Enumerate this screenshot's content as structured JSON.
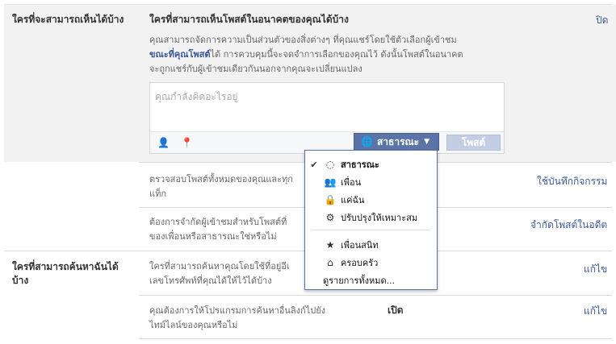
{
  "section1": {
    "title": "ใครที่จะสามารถเห็นได้บ้าง",
    "future_posts": {
      "heading": "ใครที่สามารถเห็นโพสต์ในอนาคตของคุณได้บ้าง",
      "close_link": "ปิด",
      "desc_line1": "คุณสามารถจัดการความเป็นส่วนตัวของสิ่งต่างๆ ที่คุณแชร์โดยใช้ตัวเลือกผู้เข้าชม",
      "desc_inline_link": "ขณะที่คุณโพสต์",
      "desc_line2_rest": "ได้ การควบคุมนี้จะจดจำการเลือกของคุณไว้ ดังนั้นโพสต์ในอนาคต",
      "desc_line3": "จะถูกแชร์กับผู้เข้าชมเดียวกันนอกจากคุณจะเปลี่ยนแปลง",
      "composer_placeholder": "คุณกำลังคิดอะไรอยู่",
      "audience_button": "สาธารณะ",
      "post_button": "โพสต์"
    },
    "row2": {
      "line1": "ตรวจสอบโพสต์ทั้งหมดของคุณและทุก",
      "line2": "แท็ก",
      "link": "ใช้บันทึกกิจกรรม"
    },
    "row3": {
      "line1": "ต้องการจำกัดผู้เข้าชมสำหรับโพสต์ที่",
      "line2": "ของเพื่อนหรือสาธารณะใช่หรือไม่",
      "link": "จำกัดโพสต์ในอดีต"
    }
  },
  "section2": {
    "title_line1": "ใครที่สามารถค้นหาฉันได้",
    "title_line2": "บ้าง",
    "row1": {
      "line1": "ใครที่สามารถค้นหาคุณโดยใช้ที่อยู่อีเ",
      "line2": "เลขโทรศัพท์ที่คุณได้ให้ไว้ได้บ้าง",
      "link": "แก้ไข"
    },
    "row2": {
      "line1": "คุณต้องการให้โปรแกรมการค้นหาอื่นลิงก์ไปยัง",
      "line2": "ไทม์ไลน์ของคุณหรือไม่",
      "value": "เปิด",
      "link": "แก้ไข"
    }
  },
  "audience_menu": {
    "items": [
      {
        "label": "สาธารณะ",
        "icon": "globe-icon",
        "checked": true
      },
      {
        "label": "เพื่อน",
        "icon": "friends-icon",
        "checked": false
      },
      {
        "label": "แค่ฉัน",
        "icon": "lock-icon",
        "checked": false
      },
      {
        "label": "ปรับปรุงให้เหมาะสม",
        "icon": "gear-icon",
        "checked": false
      },
      {
        "label": "เพื่อนสนิท",
        "icon": "star-icon",
        "checked": false
      },
      {
        "label": "ครอบครัว",
        "icon": "home-icon",
        "checked": false
      },
      {
        "label": "ดูรายการทั้งหมด...",
        "icon": "",
        "checked": false
      }
    ]
  },
  "colors": {
    "link": "#3b5998",
    "button": "#5b74a8",
    "post_button_disabled": "#c3cee4",
    "section_bg": "#f2f2f2"
  }
}
